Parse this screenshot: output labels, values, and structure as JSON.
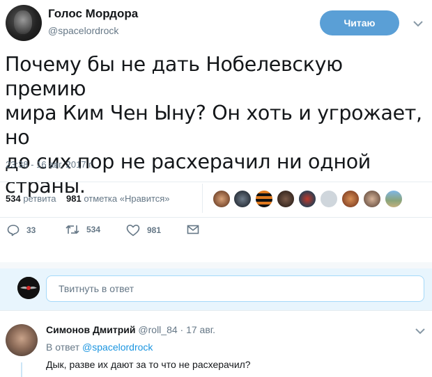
{
  "header": {
    "name": "Голос Мордора",
    "handle": "@spacelordrock",
    "follow_label": "Читаю"
  },
  "tweet": {
    "lines": [
      "Почему бы не дать Нобелевскую премию",
      "мира Ким Чен Ыну? Он хоть и угрожает, но",
      "до сих пор не расхерачил ни одной",
      "страны."
    ],
    "timestamp": "23:38 - 16 авг. 2017 г."
  },
  "stats": {
    "retweets": "534",
    "retweets_label": "ретвита",
    "likes": "981",
    "likes_label": "отметка «Нравится»"
  },
  "actions": {
    "reply_count": "33",
    "retweet_count": "534",
    "like_count": "981"
  },
  "reply_box": {
    "placeholder": "Твитнуть в ответ"
  },
  "comment": {
    "name": "Симонов Дмитрий",
    "handle": "@roll_84",
    "date": "· 17 авг.",
    "reply_to_prefix": "В ответ",
    "reply_to_handle": "@spacelordrock",
    "text": "Дык, разве их дают за то что не расхерачил?"
  },
  "colors": {
    "accent": "#1b95e0",
    "follow_button": "#5a9fd6",
    "muted_text": "#657786",
    "reply_area_bg": "#e8f5fd"
  },
  "icons": [
    "chevron-down-icon",
    "reply-icon",
    "retweet-icon",
    "like-icon",
    "dm-icon"
  ]
}
